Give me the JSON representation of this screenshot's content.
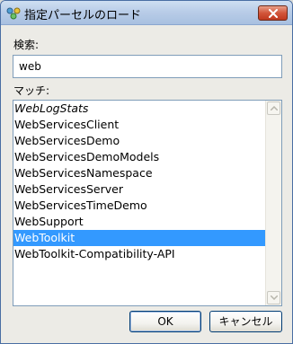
{
  "window": {
    "title": "指定パーセルのロード",
    "close_label": "×"
  },
  "search": {
    "label": "検索:",
    "value": "web"
  },
  "matches": {
    "label": "マッチ:",
    "items": [
      {
        "text": "WebLogStats",
        "italic": true,
        "selected": false
      },
      {
        "text": "WebServicesClient",
        "italic": false,
        "selected": false
      },
      {
        "text": "WebServicesDemo",
        "italic": false,
        "selected": false
      },
      {
        "text": "WebServicesDemoModels",
        "italic": false,
        "selected": false
      },
      {
        "text": "WebServicesNamespace",
        "italic": false,
        "selected": false
      },
      {
        "text": "WebServicesServer",
        "italic": false,
        "selected": false
      },
      {
        "text": "WebServicesTimeDemo",
        "italic": false,
        "selected": false
      },
      {
        "text": "WebSupport",
        "italic": false,
        "selected": false
      },
      {
        "text": "WebToolkit",
        "italic": false,
        "selected": true
      },
      {
        "text": "WebToolkit-Compatibility-API",
        "italic": false,
        "selected": false
      }
    ]
  },
  "buttons": {
    "ok_label": "OK",
    "cancel_label": "キャンセル"
  },
  "colors": {
    "selection": "#3399ff",
    "titlebar": "#b9cde8",
    "close_button": "#d2553a"
  }
}
